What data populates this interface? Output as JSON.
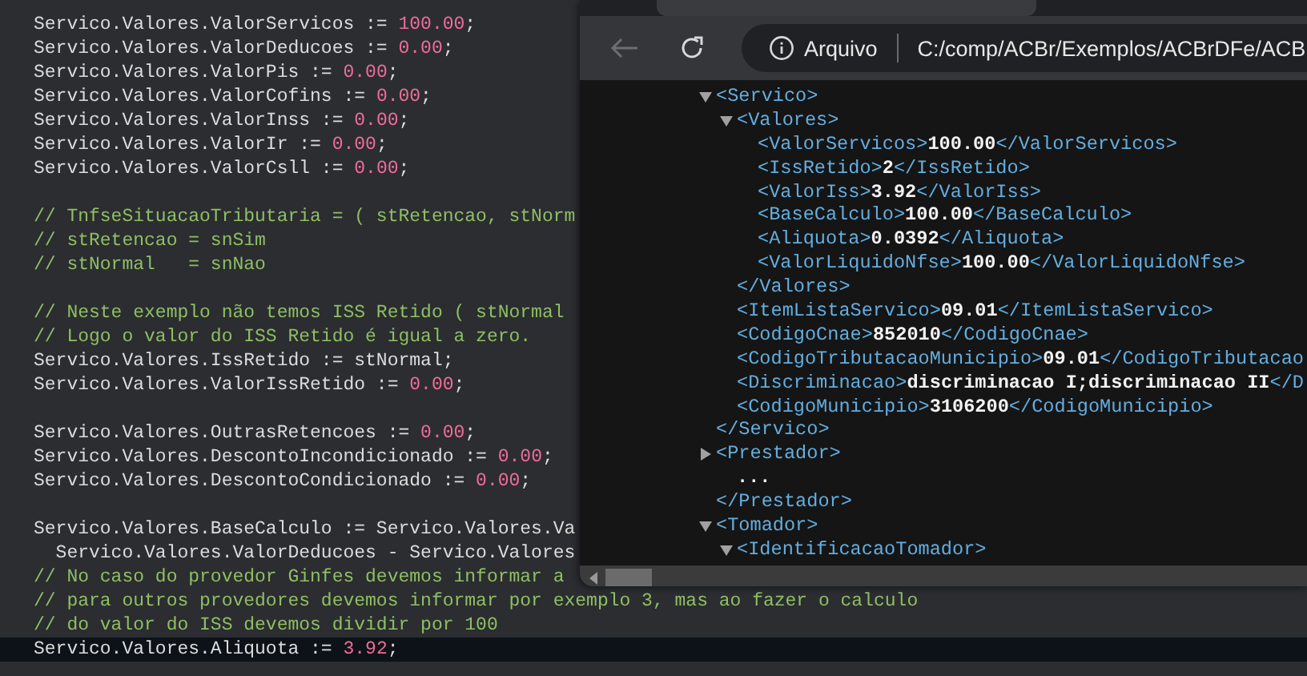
{
  "editor": {
    "blocks": [
      {
        "lines": [
          {
            "current": false,
            "tokens": [
              {
                "kind": "code",
                "text": "Servico.Valores.ValorServicos := "
              },
              {
                "kind": "number",
                "text": "100.00"
              },
              {
                "kind": "code",
                "text": ";"
              }
            ]
          },
          {
            "current": false,
            "tokens": [
              {
                "kind": "code",
                "text": "Servico.Valores.ValorDeducoes := "
              },
              {
                "kind": "number",
                "text": "0.00"
              },
              {
                "kind": "code",
                "text": ";"
              }
            ]
          },
          {
            "current": false,
            "tokens": [
              {
                "kind": "code",
                "text": "Servico.Valores.ValorPis := "
              },
              {
                "kind": "number",
                "text": "0.00"
              },
              {
                "kind": "code",
                "text": ";"
              }
            ]
          },
          {
            "current": false,
            "tokens": [
              {
                "kind": "code",
                "text": "Servico.Valores.ValorCofins := "
              },
              {
                "kind": "number",
                "text": "0.00"
              },
              {
                "kind": "code",
                "text": ";"
              }
            ]
          },
          {
            "current": false,
            "tokens": [
              {
                "kind": "code",
                "text": "Servico.Valores.ValorInss := "
              },
              {
                "kind": "number",
                "text": "0.00"
              },
              {
                "kind": "code",
                "text": ";"
              }
            ]
          },
          {
            "current": false,
            "tokens": [
              {
                "kind": "code",
                "text": "Servico.Valores.ValorIr := "
              },
              {
                "kind": "number",
                "text": "0.00"
              },
              {
                "kind": "code",
                "text": ";"
              }
            ]
          },
          {
            "current": false,
            "tokens": [
              {
                "kind": "code",
                "text": "Servico.Valores.ValorCsll := "
              },
              {
                "kind": "number",
                "text": "0.00"
              },
              {
                "kind": "code",
                "text": ";"
              }
            ]
          }
        ]
      },
      {
        "lines": [
          {
            "current": false,
            "tokens": [
              {
                "kind": "comment",
                "text": "// TnfseSituacaoTributaria = ( stRetencao, stNorm"
              }
            ]
          },
          {
            "current": false,
            "tokens": [
              {
                "kind": "comment",
                "text": "// stRetencao = snSim"
              }
            ]
          },
          {
            "current": false,
            "tokens": [
              {
                "kind": "comment",
                "text": "// stNormal   = snNao"
              }
            ]
          }
        ]
      },
      {
        "lines": [
          {
            "current": false,
            "tokens": [
              {
                "kind": "comment",
                "text": "// Neste exemplo não temos ISS Retido ( stNormal"
              }
            ]
          },
          {
            "current": false,
            "tokens": [
              {
                "kind": "comment",
                "text": "// Logo o valor do ISS Retido é igual a zero."
              }
            ]
          },
          {
            "current": false,
            "tokens": [
              {
                "kind": "code",
                "text": "Servico.Valores.IssRetido := stNormal;"
              }
            ]
          },
          {
            "current": false,
            "tokens": [
              {
                "kind": "code",
                "text": "Servico.Valores.ValorIssRetido := "
              },
              {
                "kind": "number",
                "text": "0.00"
              },
              {
                "kind": "code",
                "text": ";"
              }
            ]
          }
        ]
      },
      {
        "lines": [
          {
            "current": false,
            "tokens": [
              {
                "kind": "code",
                "text": "Servico.Valores.OutrasRetencoes := "
              },
              {
                "kind": "number",
                "text": "0.00"
              },
              {
                "kind": "code",
                "text": ";"
              }
            ]
          },
          {
            "current": false,
            "tokens": [
              {
                "kind": "code",
                "text": "Servico.Valores.DescontoIncondicionado := "
              },
              {
                "kind": "number",
                "text": "0.00"
              },
              {
                "kind": "code",
                "text": ";"
              }
            ]
          },
          {
            "current": false,
            "tokens": [
              {
                "kind": "code",
                "text": "Servico.Valores.DescontoCondicionado := "
              },
              {
                "kind": "number",
                "text": "0.00"
              },
              {
                "kind": "code",
                "text": ";"
              }
            ]
          }
        ]
      },
      {
        "lines": [
          {
            "current": false,
            "tokens": [
              {
                "kind": "code",
                "text": "Servico.Valores.BaseCalculo := Servico.Valores.Va"
              }
            ]
          },
          {
            "current": false,
            "tokens": [
              {
                "kind": "code",
                "text": "  Servico.Valores.ValorDeducoes - Servico.Valores"
              }
            ]
          },
          {
            "current": false,
            "tokens": [
              {
                "kind": "comment",
                "text": "// No caso do provedor Ginfes devemos informar a"
              }
            ]
          },
          {
            "current": false,
            "tokens": [
              {
                "kind": "comment",
                "text": "// para outros provedores devemos informar por exemplo 3, mas ao fazer o calculo"
              }
            ]
          },
          {
            "current": false,
            "tokens": [
              {
                "kind": "comment",
                "text": "// do valor do ISS devemos dividir por 100"
              }
            ]
          },
          {
            "current": true,
            "tokens": [
              {
                "kind": "code",
                "text": "Servico.Valores.Aliquota := "
              },
              {
                "kind": "number",
                "text": "3.92"
              },
              {
                "kind": "code",
                "text": ";"
              }
            ]
          }
        ]
      }
    ]
  },
  "browser": {
    "address": {
      "scheme_label": "Arquivo",
      "url": "C:/comp/ACBr/Exemplos/ACBrDFe/ACB"
    },
    "xml": [
      {
        "open": "<Servico>",
        "expanded": true,
        "children": [
          {
            "open": "<Valores>",
            "expanded": true,
            "children": [
              {
                "open": "<ValorServicos>",
                "value": "100.00",
                "close": "</ValorServicos>"
              },
              {
                "open": "<IssRetido>",
                "value": "2",
                "close": "</IssRetido>"
              },
              {
                "open": "<ValorIss>",
                "value": "3.92",
                "close": "</ValorIss>"
              },
              {
                "open": "<BaseCalculo>",
                "value": "100.00",
                "close": "</BaseCalculo>"
              },
              {
                "open": "<Aliquota>",
                "value": "0.0392",
                "close": "</Aliquota>"
              },
              {
                "open": "<ValorLiquidoNfse>",
                "value": "100.00",
                "close": "</ValorLiquidoNfse>"
              }
            ],
            "close": "</Valores>"
          },
          {
            "open": "<ItemListaServico>",
            "value": "09.01",
            "close": "</ItemListaServico>"
          },
          {
            "open": "<CodigoCnae>",
            "value": "852010",
            "close": "</CodigoCnae>"
          },
          {
            "open": "<CodigoTributacaoMunicipio>",
            "value": "09.01",
            "close": "</CodigoTributacao"
          },
          {
            "open": "<Discriminacao>",
            "value": "discriminacao I;discriminacao II",
            "close": "</D"
          },
          {
            "open": "<CodigoMunicipio>",
            "value": "3106200",
            "close": "</CodigoMunicipio>"
          }
        ],
        "close": "</Servico>"
      },
      {
        "open": "<Prestador>",
        "expanded": false,
        "ellipsis": "...",
        "close": "</Prestador>"
      },
      {
        "open": "<Tomador>",
        "expanded": true,
        "children": [
          {
            "open": "<IdentificacaoTomador>",
            "expanded": true
          }
        ]
      }
    ]
  }
}
